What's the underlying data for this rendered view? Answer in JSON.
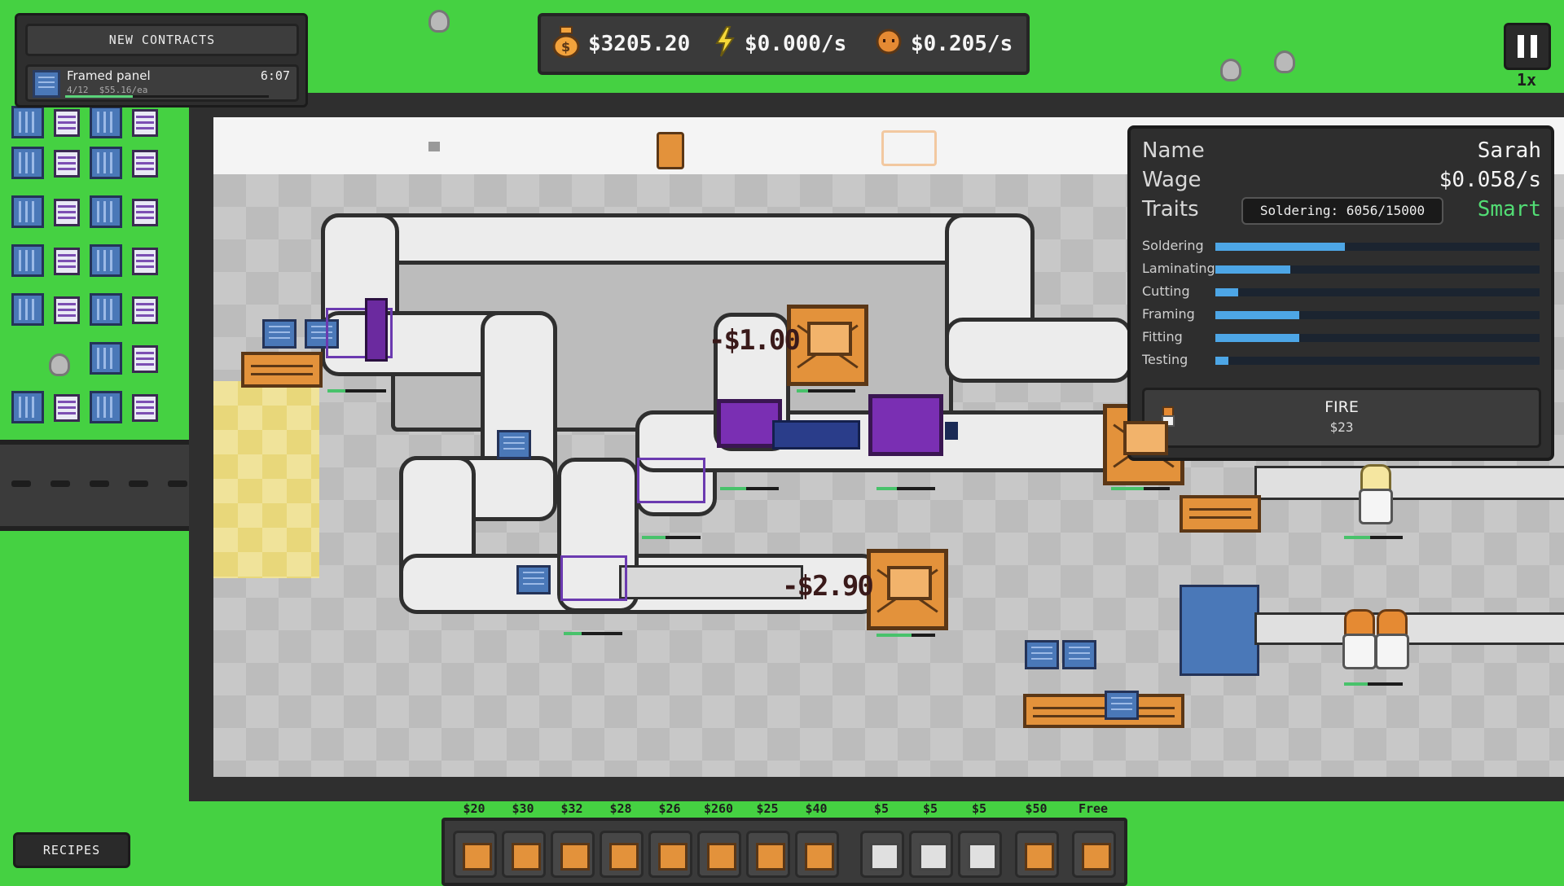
{
  "contracts": {
    "header": "NEW CONTRACTS",
    "items": [
      {
        "name": "Framed panel",
        "progress": "4/12",
        "price": "$55.16/ea",
        "timer": "6:07",
        "progress_fraction": 0.33
      }
    ]
  },
  "hud": {
    "money": "$3205.20",
    "energy_rate": "$0.000/s",
    "wage_rate": "$0.205/s"
  },
  "game": {
    "speed": "1x",
    "floating_costs": [
      "-$1.00",
      "-$2.90"
    ]
  },
  "worker_panel": {
    "name_label": "Name",
    "name": "Sarah",
    "wage_label": "Wage",
    "wage": "$0.058/s",
    "traits_label": "Traits",
    "trait_tooltip": "Soldering: 6056/15000",
    "trait": "Smart",
    "skills": [
      {
        "name": "Soldering",
        "level": 0.4
      },
      {
        "name": "Laminating",
        "level": 0.23
      },
      {
        "name": "Cutting",
        "level": 0.07
      },
      {
        "name": "Framing",
        "level": 0.26
      },
      {
        "name": "Fitting",
        "level": 0.26
      },
      {
        "name": "Testing",
        "level": 0.04
      }
    ],
    "fire_label": "FIRE",
    "fire_cost": "$23"
  },
  "toolbar": {
    "recipes_label": "RECIPES",
    "tools": [
      {
        "price": "$20",
        "icon": "crate-icon"
      },
      {
        "price": "$30",
        "icon": "solder-machine-icon"
      },
      {
        "price": "$32",
        "icon": "laminator-icon"
      },
      {
        "price": "$28",
        "icon": "cutter-icon"
      },
      {
        "price": "$26",
        "icon": "framer-icon"
      },
      {
        "price": "$260",
        "icon": "fitter-icon"
      },
      {
        "price": "$25",
        "icon": "tester-icon"
      },
      {
        "price": "$40",
        "icon": "box-icon"
      },
      {
        "price": "$5",
        "icon": "belt-straight-icon"
      },
      {
        "price": "$5",
        "icon": "belt-corner-icon"
      },
      {
        "price": "$5",
        "icon": "belt-split-icon"
      },
      {
        "price": "$50",
        "icon": "sign-icon"
      },
      {
        "price": "Free",
        "icon": "worker-icon"
      }
    ]
  },
  "colors": {
    "grass": "#45d142",
    "panel": "#2e2e2e",
    "trait_green": "#52dd74",
    "skill_bar": "#4da6e6",
    "crate": "#e3923b",
    "machine": "#7a2fb3",
    "solar_panel": "#4a78b8"
  }
}
